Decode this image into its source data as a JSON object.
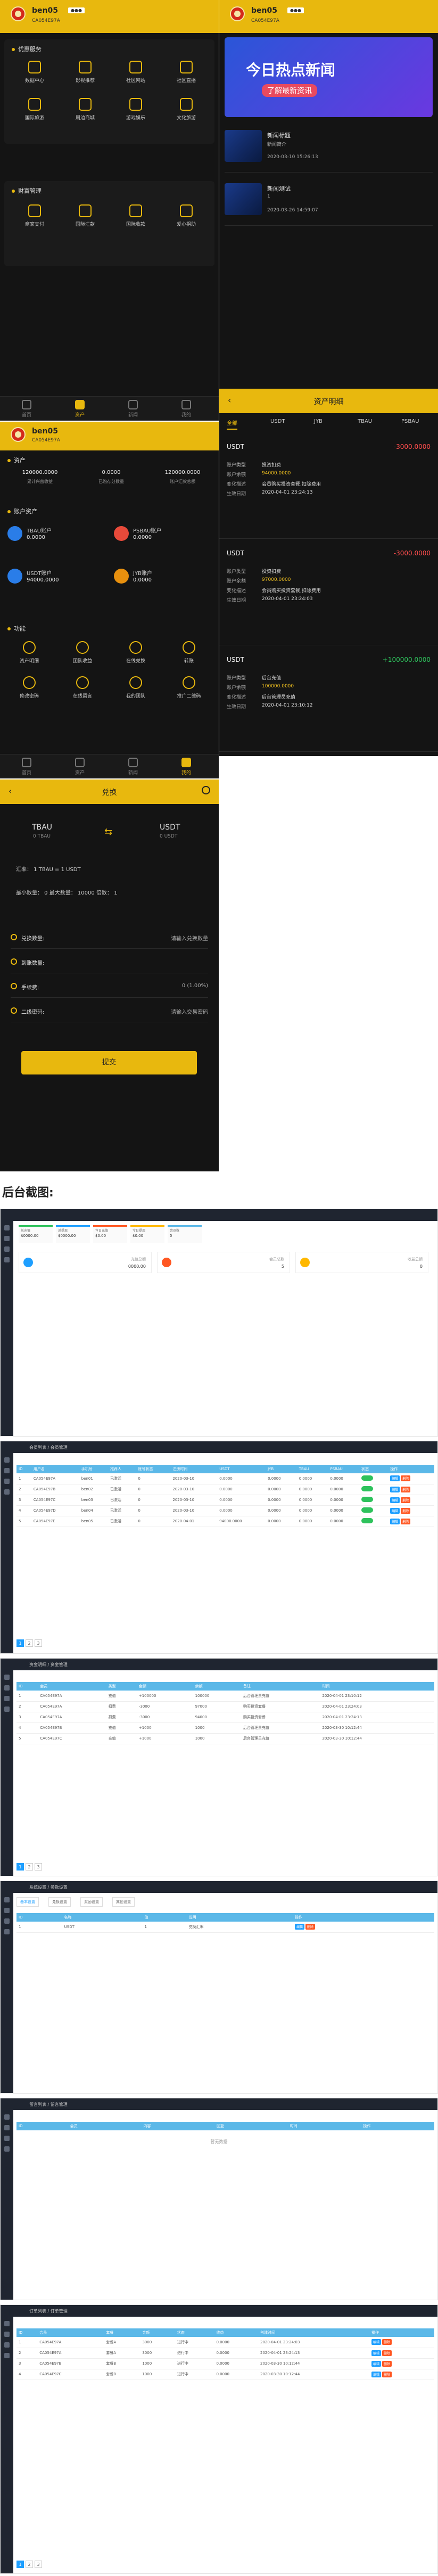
{
  "user": {
    "name": "ben05",
    "code": "CA054E97A",
    "badge": "●●●",
    "logo_text": "币天下"
  },
  "home": {
    "service_title": "优惠服务",
    "service_items": [
      "数据中心",
      "影视推荐",
      "社区网站",
      "社区直播",
      "国际旅游",
      "周边商城",
      "游戏娱乐",
      "文化旅游"
    ],
    "finance_title": "财富管理",
    "finance_items": [
      "商家支付",
      "国际汇款",
      "国际收款",
      "爱心捐助"
    ]
  },
  "tabs": [
    "首页",
    "资产",
    "新闻",
    "我的"
  ],
  "news": {
    "banner_big": "今日热点新闻",
    "banner_small": "了解最新资讯",
    "items": [
      {
        "title": "新闻标题",
        "sub": "新闻简介",
        "date": "2020-03-10 15:26:13"
      },
      {
        "title": "新闻测试",
        "sub": "1",
        "date": "2020-03-26 14:59:07"
      }
    ]
  },
  "assets": {
    "title": "资产",
    "stats": [
      {
        "value": "120000.0000",
        "label": "累计兴益收益"
      },
      {
        "value": "0.0000",
        "label": "已购存分数量"
      },
      {
        "value": "120000.0000",
        "label": "账户汇款总额"
      }
    ],
    "acct_title": "账户资产",
    "accounts": [
      {
        "name": "TBAU账户",
        "amount": "0.0000"
      },
      {
        "name": "PSBAU账户",
        "amount": "0.0000"
      },
      {
        "name": "USDT账户",
        "amount": "94000.0000"
      },
      {
        "name": "JYB账户",
        "amount": "0.0000"
      }
    ],
    "func_title": "功能",
    "funcs": [
      "资产明细",
      "团队收益",
      "在线兑换",
      "转账",
      "修改密码",
      "在线留言",
      "我的团队",
      "推广二维码"
    ]
  },
  "detail": {
    "title": "资产明细",
    "filters": [
      "全部",
      "USDT",
      "JYB",
      "TBAU",
      "PSBAU"
    ],
    "labels": [
      "账户类型",
      "账户余额",
      "变化描述",
      "生效日期"
    ],
    "records": [
      {
        "currency": "USDT",
        "change": "-3000.0000",
        "type": "投资扣费",
        "balance": "94000.0000",
        "desc": "会员购买投资套餐,扣除费用",
        "date": "2020-04-01 23:24:13"
      },
      {
        "currency": "USDT",
        "change": "-3000.0000",
        "type": "投资扣费",
        "balance": "97000.0000",
        "desc": "会员购买投资套餐,扣除费用",
        "date": "2020-04-01 23:24:03"
      },
      {
        "currency": "USDT",
        "change": "+100000.0000",
        "type": "后台充值",
        "balance": "100000.0000",
        "desc": "后台管理员充值",
        "date": "2020-04-01 23:10:12"
      }
    ]
  },
  "exchange": {
    "title": "兑换",
    "from": "TBAU",
    "from_sub": "0 TBAU",
    "to": "USDT",
    "to_sub": "0 USDT",
    "rate": "汇率： 1 TBAU = 1 USDT",
    "limits": "最小数量： 0  最大数量： 10000  倍数： 1",
    "fields": [
      {
        "label": "兑换数量:",
        "value": "请输入兑换数量"
      },
      {
        "label": "到账数量:",
        "value": ""
      },
      {
        "label": "手续费:",
        "value": "0 (1.00%)"
      },
      {
        "label": "二级密码:",
        "value": "请输入交易密码"
      }
    ],
    "submit": "提交"
  },
  "backend_heading": "后台截图:",
  "admin": {
    "dash_cards": [
      {
        "label": "总充值",
        "value": "$0000.00"
      },
      {
        "label": "总提现",
        "value": "$0000.00"
      },
      {
        "label": "今日充值",
        "value": "$0.00"
      },
      {
        "label": "今日提现",
        "value": "$0.00"
      },
      {
        "label": "会员数",
        "value": "5"
      }
    ],
    "dash_stats": [
      {
        "label": "充值总额",
        "value": "0000.00"
      },
      {
        "label": "会员总数",
        "value": "5"
      },
      {
        "label": "收益总额",
        "value": "0"
      }
    ],
    "users_crumb": "会员列表 / 会员管理",
    "users_headers": [
      "ID",
      "用户名",
      "手机号",
      "推荐人",
      "账号状态",
      "注册时间",
      "USDT",
      "JYB",
      "TBAU",
      "PSBAU",
      "状态",
      "操作"
    ],
    "users_rows": [
      [
        "1",
        "CA054E97A",
        "ben01",
        "已激活",
        "0",
        "2020-03-10",
        "0.0000",
        "0.0000",
        "0.0000",
        "0.0000"
      ],
      [
        "2",
        "CA054E97B",
        "ben02",
        "已激活",
        "0",
        "2020-03-10",
        "0.0000",
        "0.0000",
        "0.0000",
        "0.0000"
      ],
      [
        "3",
        "CA054E97C",
        "ben03",
        "已激活",
        "0",
        "2020-03-10",
        "0.0000",
        "0.0000",
        "0.0000",
        "0.0000"
      ],
      [
        "4",
        "CA054E97D",
        "ben04",
        "已激活",
        "0",
        "2020-03-10",
        "0.0000",
        "0.0000",
        "0.0000",
        "0.0000"
      ],
      [
        "5",
        "CA054E97E",
        "ben05",
        "已激活",
        "0",
        "2020-04-01",
        "94000.0000",
        "0.0000",
        "0.0000",
        "0.0000"
      ]
    ],
    "log_crumb": "资金明细 / 资金管理",
    "log_headers": [
      "ID",
      "会员",
      "类型",
      "金额",
      "余额",
      "备注",
      "时间"
    ],
    "log_rows": [
      [
        "1",
        "CA054E97A",
        "充值",
        "+100000",
        "100000",
        "后台管理员充值",
        "2020-04-01 23:10:12"
      ],
      [
        "2",
        "CA054E97A",
        "扣费",
        "-3000",
        "97000",
        "购买投资套餐",
        "2020-04-01 23:24:03"
      ],
      [
        "3",
        "CA054E97A",
        "扣费",
        "-3000",
        "94000",
        "购买投资套餐",
        "2020-04-01 23:24:13"
      ],
      [
        "4",
        "CA054E97B",
        "充值",
        "+1000",
        "1000",
        "后台管理员充值",
        "2020-03-30 10:12:44"
      ],
      [
        "5",
        "CA054E97C",
        "充值",
        "+1000",
        "1000",
        "后台管理员充值",
        "2020-03-30 10:12:44"
      ]
    ],
    "cfg_crumb": "系统设置 / 参数设置",
    "cfg_tabs": [
      "基本设置",
      "兑换设置",
      "奖励设置",
      "其他设置"
    ],
    "cfg_headers": [
      "ID",
      "名称",
      "值",
      "说明",
      "操作"
    ],
    "cfg_rows": [
      [
        "1",
        "USDT",
        "1",
        "兑换汇率"
      ]
    ],
    "msg_crumb": "留言列表 / 留言管理",
    "msg_headers": [
      "ID",
      "会员",
      "内容",
      "回复",
      "时间",
      "操作"
    ],
    "msg_empty": "暂无数据",
    "order_crumb": "订单列表 / 订单管理",
    "order_headers": [
      "ID",
      "会员",
      "套餐",
      "金额",
      "状态",
      "收益",
      "创建时间",
      "操作"
    ],
    "order_rows": [
      [
        "1",
        "CA054E97A",
        "套餐A",
        "3000",
        "进行中",
        "0.0000",
        "2020-04-01 23:24:03"
      ],
      [
        "2",
        "CA054E97A",
        "套餐A",
        "3000",
        "进行中",
        "0.0000",
        "2020-04-01 23:24:13"
      ],
      [
        "3",
        "CA054E97B",
        "套餐B",
        "1000",
        "进行中",
        "0.0000",
        "2020-03-30 10:12:44"
      ],
      [
        "4",
        "CA054E97C",
        "套餐B",
        "1000",
        "进行中",
        "0.0000",
        "2020-03-30 10:12:44"
      ]
    ],
    "pager": [
      "1",
      "2",
      "3"
    ],
    "edit": "编辑",
    "del": "删除"
  },
  "colors": {
    "accent": "#e8b80e",
    "dark": "#141414",
    "table_head": "#5bb8e8"
  }
}
